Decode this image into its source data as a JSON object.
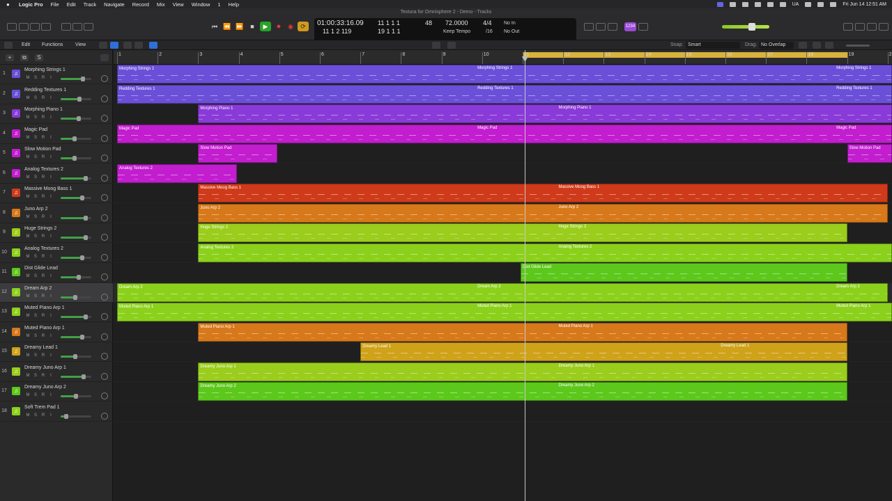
{
  "menubar": {
    "apple": "",
    "items": [
      "Logic Pro",
      "File",
      "Edit",
      "Track",
      "Navigate",
      "Record",
      "Mix",
      "View",
      "Window",
      "1",
      "Help"
    ],
    "input_source": "UA",
    "clock": "Fri Jun 14  12:51 AM"
  },
  "window": {
    "title": "Textura for Omnisphere 2 - Demo - Tracks"
  },
  "lcd": {
    "time": "01:00:33:16.09",
    "bars_top": "11  1  1     1",
    "bars_bottom": "11  1  2  119",
    "pos2_top": "11  1  1     1",
    "pos2_bottom": "19  1  1     1",
    "bar_count": "48",
    "tempo": "72.0000",
    "tempo_mode": "Keep Tempo",
    "sig_top": "4/4",
    "sig_bottom": "/16",
    "in": "No In",
    "out": "No Out"
  },
  "cpu_badge": "1234",
  "toolbar": {
    "edit": "Edit",
    "functions": "Functions",
    "view": "View",
    "snap_label": "Snap:",
    "snap_value": "Smart",
    "drag_label": "Drag:",
    "drag_value": "No Overlap"
  },
  "header_tools": {
    "plus": "+",
    "dup": "⧉",
    "solo": "S"
  },
  "ruler": {
    "bars": [
      "1",
      "2",
      "3",
      "4",
      "5",
      "6",
      "7",
      "8",
      "9",
      "10",
      "11",
      "12",
      "13",
      "14",
      "15",
      "16",
      "17",
      "18",
      "19",
      "20"
    ]
  },
  "tracks": [
    {
      "num": "1",
      "name": "Morphing Strings 1",
      "color": "#6b4fd8",
      "vol": 0.72
    },
    {
      "num": "2",
      "name": "Redding Textures 1",
      "color": "#6b4fd8",
      "vol": 0.62
    },
    {
      "num": "3",
      "name": "Morphing Piano 1",
      "color": "#8a3ad8",
      "vol": 0.6
    },
    {
      "num": "4",
      "name": "Magic Pad",
      "color": "#c21dcf",
      "vol": 0.45
    },
    {
      "num": "5",
      "name": "Slow Motion Pad",
      "color": "#c21dcf",
      "vol": 0.45
    },
    {
      "num": "6",
      "name": "Analog Textures 2",
      "color": "#c21dcf",
      "vol": 0.82
    },
    {
      "num": "7",
      "name": "Massive Moog Bass 1",
      "color": "#cf3a1a",
      "vol": 0.7
    },
    {
      "num": "8",
      "name": "Juno Arp 2",
      "color": "#d7781a",
      "vol": 0.82
    },
    {
      "num": "9",
      "name": "Huge Strings 2",
      "color": "#9acd1c",
      "vol": 0.82
    },
    {
      "num": "10",
      "name": "Analog Textures 2",
      "color": "#8bd11c",
      "vol": 0.7
    },
    {
      "num": "11",
      "name": "Dist Glide Lead",
      "color": "#5dc81c",
      "vol": 0.58
    },
    {
      "num": "12",
      "name": "Dream Arp 2",
      "color": "#8bd11c",
      "vol": 0.48
    },
    {
      "num": "13",
      "name": "Muted Piano Arp 1",
      "color": "#8bd11c",
      "vol": 0.82
    },
    {
      "num": "14",
      "name": "Muted Piano Arp 1",
      "color": "#d7781a",
      "vol": 0.7
    },
    {
      "num": "15",
      "name": "Dreamy Lead 1",
      "color": "#cfa21a",
      "vol": 0.48
    },
    {
      "num": "16",
      "name": "Dreamy Juno Arp 1",
      "color": "#9acd1c",
      "vol": 0.74
    },
    {
      "num": "17",
      "name": "Dreamy Juno Arp 2",
      "color": "#5dc81c",
      "vol": 0.5
    },
    {
      "num": "18",
      "name": "Soft Trem Pad 1",
      "color": "#8bd11c",
      "vol": 0.18
    }
  ],
  "track_button_labels": {
    "mute": "M",
    "solo": "S",
    "rec": "R",
    "input": "I"
  },
  "regions": [
    {
      "track": 1,
      "name": "Morphing Strings 1",
      "start": 1,
      "end": 20.1,
      "color": "#6b4fd8"
    },
    {
      "track": 1,
      "name": "Morphing Strings 1",
      "start": 9.85,
      "end": 9.85,
      "color": "#6b4fd8",
      "label_only": true
    },
    {
      "track": 1,
      "name": "Morphing Strings 1",
      "start": 18.7,
      "end": 18.7,
      "color": "#6b4fd8",
      "label_only": true
    },
    {
      "track": 2,
      "name": "Redding Textures 1",
      "start": 1,
      "end": 20.1,
      "color": "#6b4fd8"
    },
    {
      "track": 2,
      "name": "Redding Textures 1",
      "start": 9.85,
      "end": 9.85,
      "color": "#6b4fd8",
      "label_only": true
    },
    {
      "track": 2,
      "name": "Redding Textures 1",
      "start": 18.7,
      "end": 18.7,
      "color": "#6b4fd8",
      "label_only": true
    },
    {
      "track": 3,
      "name": "Morphing Piano 1",
      "start": 3,
      "end": 20.1,
      "color": "#8a3ad8"
    },
    {
      "track": 3,
      "name": "Morphing Piano 1",
      "start": 11.85,
      "end": 11.85,
      "color": "#8a3ad8",
      "label_only": true
    },
    {
      "track": 4,
      "name": "Magic Pad",
      "start": 1,
      "end": 20.1,
      "color": "#c21dcf"
    },
    {
      "track": 4,
      "name": "Magic Pad",
      "start": 9.85,
      "end": 9.85,
      "color": "#c21dcf",
      "label_only": true
    },
    {
      "track": 4,
      "name": "Magic Pad",
      "start": 18.7,
      "end": 18.7,
      "color": "#c21dcf",
      "label_only": true
    },
    {
      "track": 5,
      "name": "Slow Motion Pad",
      "start": 3,
      "end": 4.95,
      "color": "#c21dcf"
    },
    {
      "track": 5,
      "name": "Slow Motion Pad",
      "start": 19,
      "end": 20.1,
      "color": "#c21dcf"
    },
    {
      "track": 6,
      "name": "Analog Textures 2",
      "start": 1,
      "end": 3.95,
      "color": "#c21dcf"
    },
    {
      "track": 7,
      "name": "Massive Moog Bass 1",
      "start": 3,
      "end": 20,
      "color": "#cf3a1a"
    },
    {
      "track": 7,
      "name": "Massive Moog Bass 1",
      "start": 11.85,
      "end": 11.85,
      "color": "#cf3a1a",
      "label_only": true
    },
    {
      "track": 8,
      "name": "Juno Arp 2",
      "start": 3,
      "end": 20,
      "color": "#d7781a"
    },
    {
      "track": 8,
      "name": "Juno Arp 2",
      "start": 11.85,
      "end": 11.85,
      "color": "#d7781a",
      "label_only": true
    },
    {
      "track": 9,
      "name": "Huge Strings 2",
      "start": 3,
      "end": 19,
      "color": "#9acd1c"
    },
    {
      "track": 9,
      "name": "Huge Strings 2",
      "start": 11.85,
      "end": 11.85,
      "color": "#9acd1c",
      "label_only": true
    },
    {
      "track": 10,
      "name": "Analog Textures 2",
      "start": 3,
      "end": 20.1,
      "color": "#8bd11c"
    },
    {
      "track": 10,
      "name": "Analog Textures 2",
      "start": 11.85,
      "end": 11.85,
      "color": "#8bd11c",
      "label_only": true
    },
    {
      "track": 11,
      "name": "Dist Glide Lead",
      "start": 10.95,
      "end": 19,
      "color": "#5dc81c"
    },
    {
      "track": 12,
      "name": "Dream Arp 2",
      "start": 1,
      "end": 20,
      "color": "#8bd11c"
    },
    {
      "track": 12,
      "name": "Dream Arp 2",
      "start": 9.85,
      "end": 9.85,
      "color": "#8bd11c",
      "label_only": true
    },
    {
      "track": 12,
      "name": "Dream Arp 2",
      "start": 18.7,
      "end": 18.7,
      "color": "#8bd11c",
      "label_only": true
    },
    {
      "track": 13,
      "name": "Muted Piano Arp 1",
      "start": 1,
      "end": 20.1,
      "color": "#8bd11c"
    },
    {
      "track": 13,
      "name": "Muted Piano Arp 1",
      "start": 9.85,
      "end": 9.85,
      "color": "#8bd11c",
      "label_only": true
    },
    {
      "track": 13,
      "name": "Muted Piano Arp 1",
      "start": 18.7,
      "end": 18.7,
      "color": "#8bd11c",
      "label_only": true
    },
    {
      "track": 14,
      "name": "Muted Piano Arp 1",
      "start": 3,
      "end": 19,
      "color": "#d7781a"
    },
    {
      "track": 14,
      "name": "Muted Piano Arp 1",
      "start": 11.85,
      "end": 11.85,
      "color": "#d7781a",
      "label_only": true
    },
    {
      "track": 15,
      "name": "Dreamy Lead 1",
      "start": 7,
      "end": 19,
      "color": "#cfa21a"
    },
    {
      "track": 15,
      "name": "Dreamy Lead 1",
      "start": 15.85,
      "end": 15.85,
      "color": "#cfa21a",
      "label_only": true
    },
    {
      "track": 16,
      "name": "Dreamy Juno Arp 1",
      "start": 3,
      "end": 19,
      "color": "#9acd1c"
    },
    {
      "track": 16,
      "name": "Dreamy Juno Arp 1",
      "start": 11.85,
      "end": 11.85,
      "color": "#9acd1c",
      "label_only": true
    },
    {
      "track": 17,
      "name": "Dreamy Juno Arp 2",
      "start": 3,
      "end": 19,
      "color": "#5dc81c"
    },
    {
      "track": 17,
      "name": "Dreamy Juno Arp 2",
      "start": 11.85,
      "end": 11.85,
      "color": "#5dc81c",
      "label_only": true
    }
  ],
  "cycle": {
    "start": 11,
    "end": 19
  },
  "playhead_bar": 11.05,
  "selected_track": 12
}
